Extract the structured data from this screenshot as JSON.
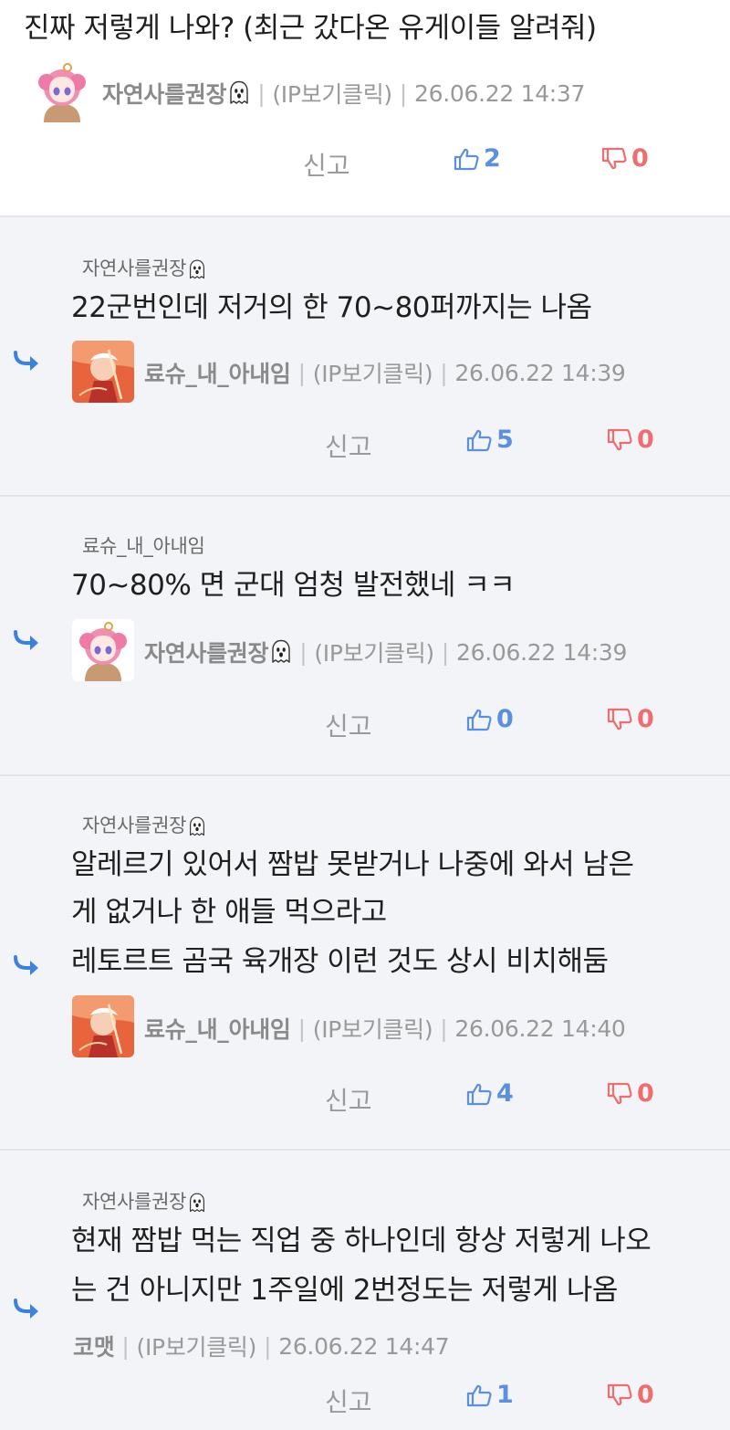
{
  "post": {
    "text": "진짜 저렇게 나와? (최근 갔다온 유게이들 알려줘)",
    "author": "자연사를권장",
    "ip": "(IP보기클릭)",
    "timestamp": "26.06.22 14:37",
    "report": "신고",
    "up": "2",
    "down": "0"
  },
  "replies": [
    {
      "mention": "자연사를권장",
      "lines": [
        "22군번인데 저거의 한 70~80퍼까지는 나옴"
      ],
      "author": "료슈_내_아내임",
      "ip": "(IP보기클릭)",
      "timestamp": "26.06.22 14:39",
      "report": "신고",
      "up": "5",
      "down": "0"
    },
    {
      "mention": "료슈_내_아내임",
      "lines": [
        "70~80% 면 군대 엄청 발전했네 ㅋㅋ"
      ],
      "author": "자연사를권장",
      "ip": "(IP보기클릭)",
      "timestamp": "26.06.22 14:39",
      "report": "신고",
      "up": "0",
      "down": "0"
    },
    {
      "mention": "자연사를권장",
      "lines": [
        "알레르기 있어서 짬밥 못받거나 나중에 와서 남은",
        "게 없거나 한 애들 먹으라고",
        "레토르트 곰국 육개장 이런 것도 상시 비치해둠"
      ],
      "author": "료슈_내_아내임",
      "ip": "(IP보기클릭)",
      "timestamp": "26.06.22 14:40",
      "report": "신고",
      "up": "4",
      "down": "0"
    },
    {
      "mention": "자연사를권장",
      "lines": [
        "현재 짬밥 먹는 직업 중 하나인데 항상 저렇게 나오",
        "는 건 아니지만 1주일에 2번정도는 저렇게 나옴"
      ],
      "author": "코맷",
      "ip": "(IP보기클릭)",
      "timestamp": "26.06.22 14:47",
      "report": "신고",
      "up": "1",
      "down": "0"
    }
  ],
  "colors": {
    "upvote": "#5b8fe0",
    "downvote": "#ef6d6d",
    "reply_background": "#f2f4f7",
    "reply_arrow": "#3b82e0"
  },
  "icons": {
    "thumbs_up": "thumbs-up-icon",
    "thumbs_down": "thumbs-down-icon",
    "reply_arrow": "reply-arrow-icon",
    "nickname_badge": "ghost-icon"
  }
}
